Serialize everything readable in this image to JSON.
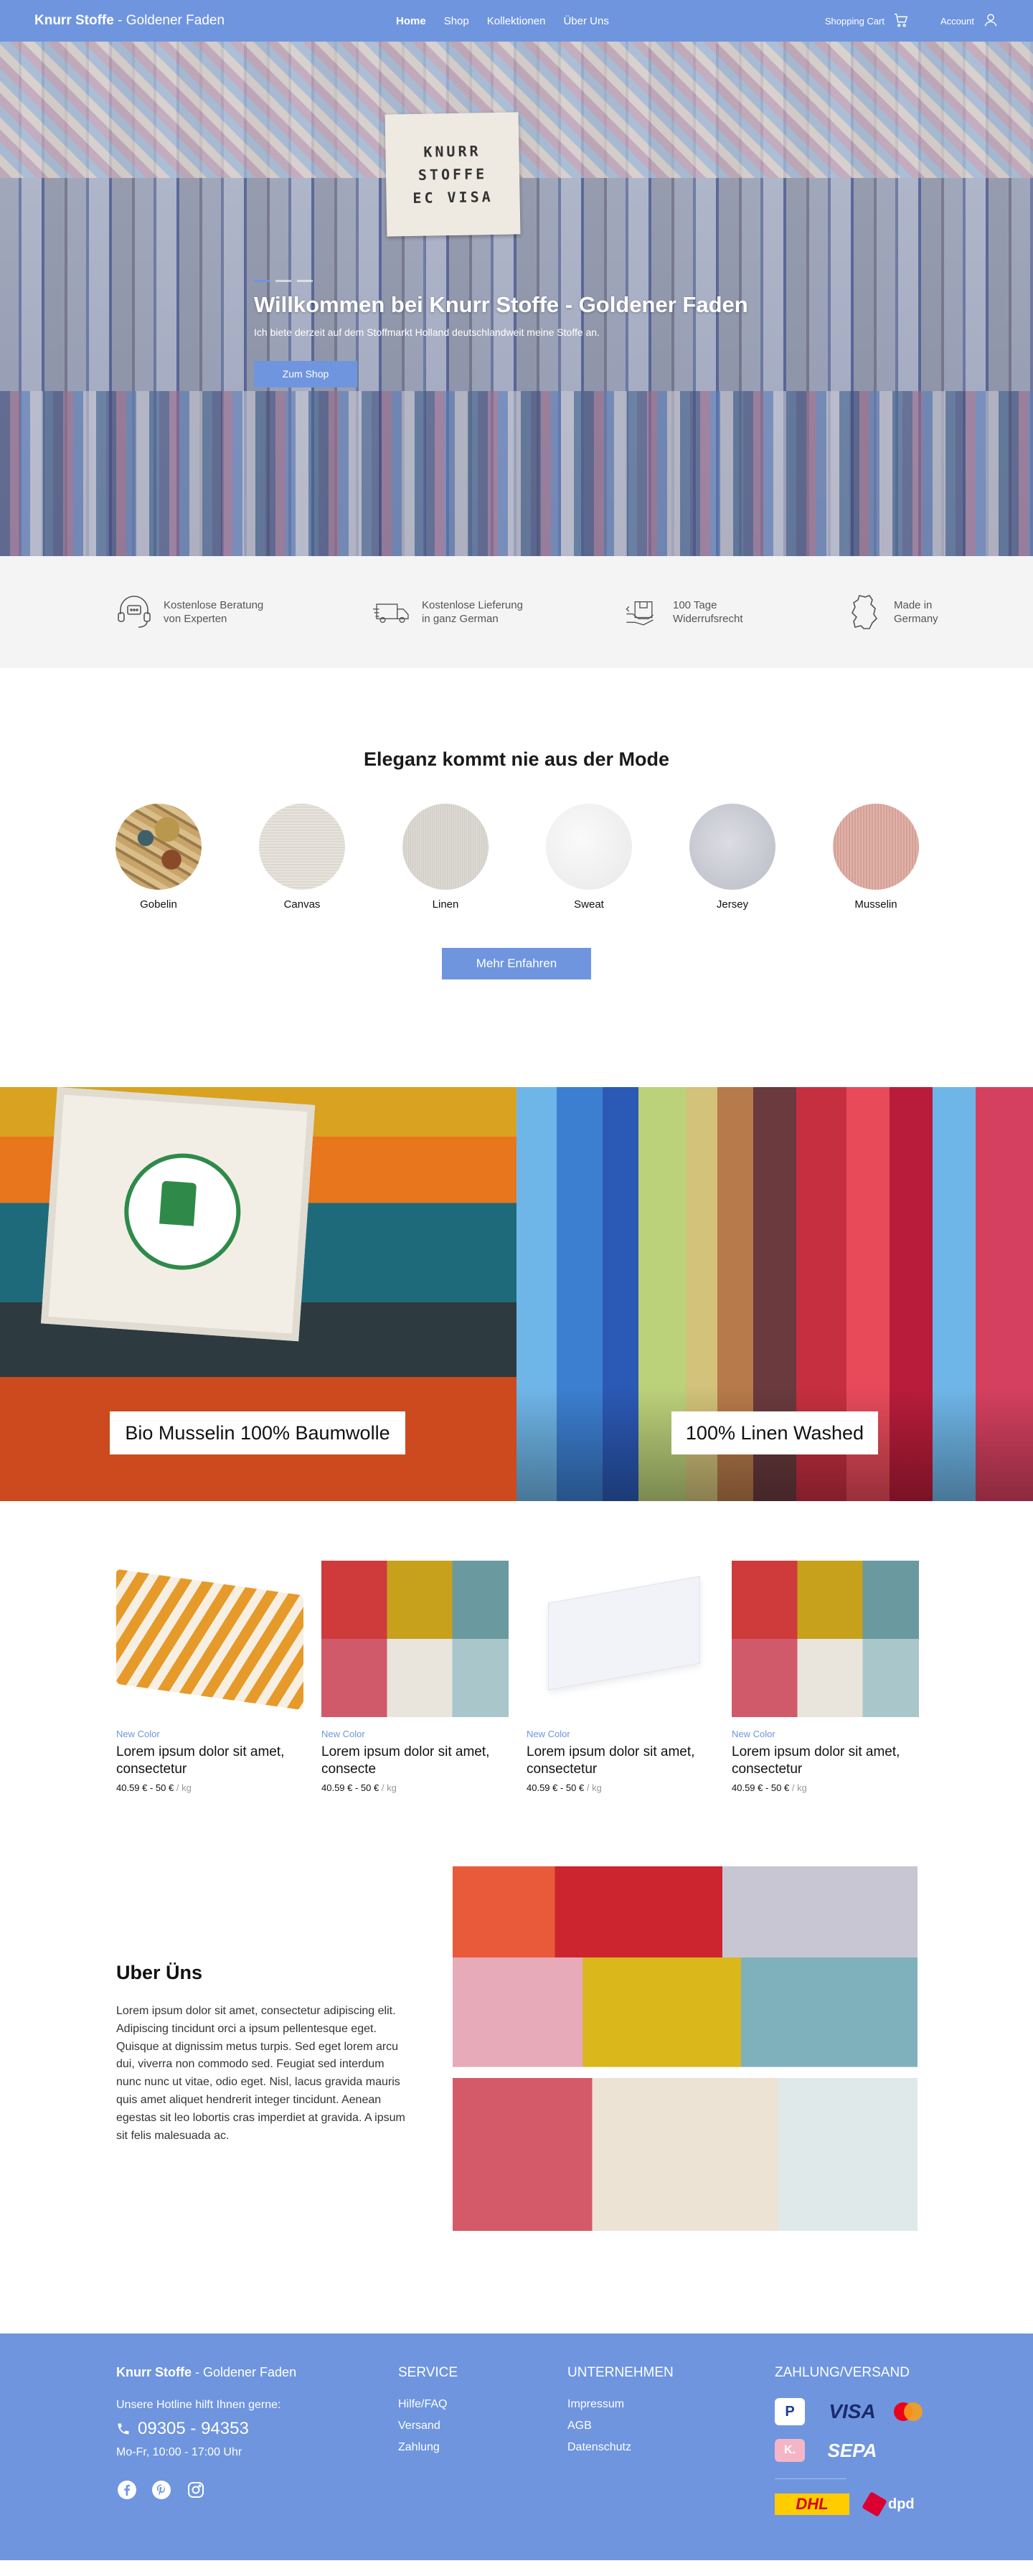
{
  "nav": {
    "brand_bold": "Knurr Stoffe",
    "brand_sep": " - ",
    "brand_rest": "Goldener Faden",
    "links": [
      "Home",
      "Shop",
      "Kollektionen",
      "Über Uns"
    ],
    "active": "Home",
    "cart_label": "Shopping Cart",
    "account_label": "Account"
  },
  "hero": {
    "sign_lines": [
      "KNURR",
      "STOFFE",
      "EC VISA"
    ],
    "title": "Willkommen bei Knurr Stoffe - Goldener Faden",
    "subtitle": "Ich biete derzeit auf dem Stoffmarkt Holland deutschlandweit meine Stoffe an.",
    "cta": "Zum Shop",
    "slides": 3,
    "active_slide": 1
  },
  "features": [
    {
      "icon": "chat-headset-icon",
      "line1": "Kostenlose Beratung",
      "line2": "von Experten"
    },
    {
      "icon": "delivery-truck-icon",
      "line1": "Kostenlose Lieferung",
      "line2": "in ganz German"
    },
    {
      "icon": "return-box-icon",
      "line1": "100 Tage",
      "line2": "Widerrufsrecht"
    },
    {
      "icon": "germany-map-icon",
      "line1": "Made in",
      "line2": "Germany"
    }
  ],
  "categories": {
    "title": "Eleganz kommt nie aus der Mode",
    "items": [
      "Gobelin",
      "Canvas",
      "Linen",
      "Sweat",
      "Jersey",
      "Musselin"
    ],
    "cta": "Mehr Enfahren"
  },
  "banners": [
    {
      "label": "Bio Musselin 100% Baumwolle"
    },
    {
      "label": "100% Linen Washed"
    }
  ],
  "products": [
    {
      "tag": "New Color",
      "title": "Lorem ipsum dolor sit amet, consectetur",
      "price": "40.59 € - 50 €",
      "unit": " / kg"
    },
    {
      "tag": "New Color",
      "title": "Lorem ipsum dolor sit amet, consecte",
      "price": "40.59 € - 50 €",
      "unit": " / kg"
    },
    {
      "tag": "New Color",
      "title": "Lorem ipsum dolor sit amet, consectetur",
      "price": "40.59 € - 50 €",
      "unit": " / kg"
    },
    {
      "tag": "New Color",
      "title": "Lorem ipsum dolor sit amet, consectetur",
      "price": "40.59 € - 50 €",
      "unit": " / kg"
    }
  ],
  "about": {
    "title": "Uber Üns",
    "body": "Lorem ipsum dolor sit amet, consectetur adipiscing elit. Adipiscing tincidunt orci a ipsum pellentesque eget. Quisque at dignissim metus turpis. Sed eget lorem arcu dui, viverra non commodo sed. Feugiat sed interdum nunc nunc ut vitae, odio eget. Nisl, lacus gravida mauris quis amet aliquet hendrerit integer tincidunt. Aenean egestas sit leo lobortis cras imperdiet at gravida. A ipsum sit felis malesuada ac."
  },
  "footer": {
    "brand_bold": "Knurr Stoffe",
    "brand_rest": " - Goldener Faden",
    "hotline_label": "Unsere Hotline hilft Ihnen gerne:",
    "phone": "09305 - 94353",
    "hours": "Mo-Fr, 10:00 - 17:00 Uhr",
    "socials": [
      "facebook-icon",
      "pinterest-icon",
      "instagram-icon"
    ],
    "service": {
      "heading": "SERVICE",
      "links": [
        "Hilfe/FAQ",
        "Versand",
        "Zahlung"
      ]
    },
    "company": {
      "heading": "UNTERNEHMEN",
      "links": [
        "Impressum",
        "AGB",
        "Datenschutz"
      ]
    },
    "payment": {
      "heading": "ZAHLUNG/VERSAND",
      "methods": [
        "PayPal",
        "VISA",
        "Mastercard",
        "Klarna",
        "SEPA"
      ],
      "shipping": [
        "DHL",
        "dpd"
      ]
    },
    "paypal_mark": "P",
    "visa_mark": "VISA",
    "klarna_mark": "K.",
    "sepa_mark": "SEPA",
    "dhl_mark": "DHL",
    "dpd_mark": "dpd"
  },
  "colors": {
    "accent": "#6f95df",
    "feature_bg": "#f4f4f4",
    "text": "#1a1a1a"
  }
}
